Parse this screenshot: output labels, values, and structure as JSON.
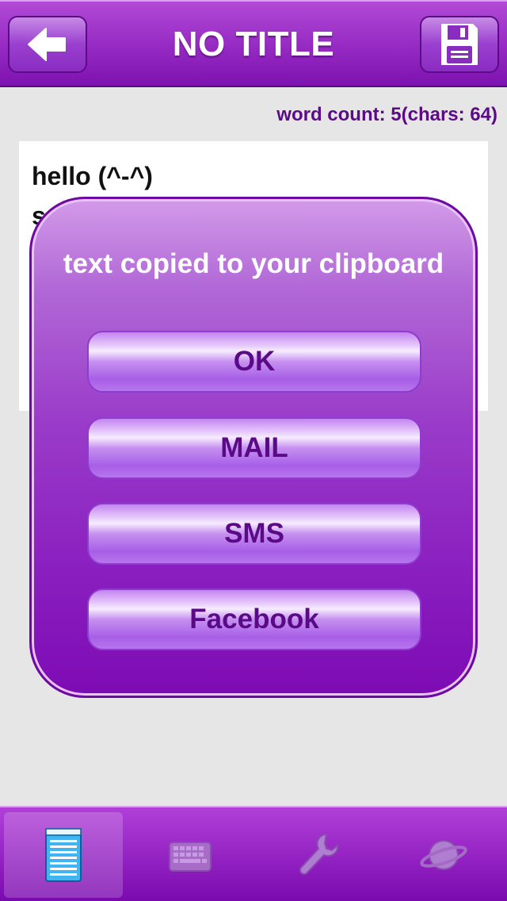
{
  "header": {
    "title": "NO TITLE",
    "back_icon": "back-arrow-icon",
    "save_icon": "floppy-disk-icon"
  },
  "status": {
    "word_count": "word count: 5(chars: 64)"
  },
  "editor": {
    "line1": "hello (^-^)",
    "line2": "s"
  },
  "dialog": {
    "message": "text copied to your clipboard",
    "buttons": [
      "OK",
      "MAIL",
      "SMS",
      "Facebook"
    ]
  },
  "tabbar": {
    "tabs": [
      {
        "icon": "notepad-icon",
        "active": true
      },
      {
        "icon": "keyboard-icon",
        "active": false
      },
      {
        "icon": "wrench-icon",
        "active": false
      },
      {
        "icon": "planet-icon",
        "active": false
      }
    ]
  },
  "colors": {
    "accent": "#8a1fbf",
    "header": "#9b2fc6",
    "button_text": "#5a0a86",
    "background": "#e6e6e6"
  }
}
